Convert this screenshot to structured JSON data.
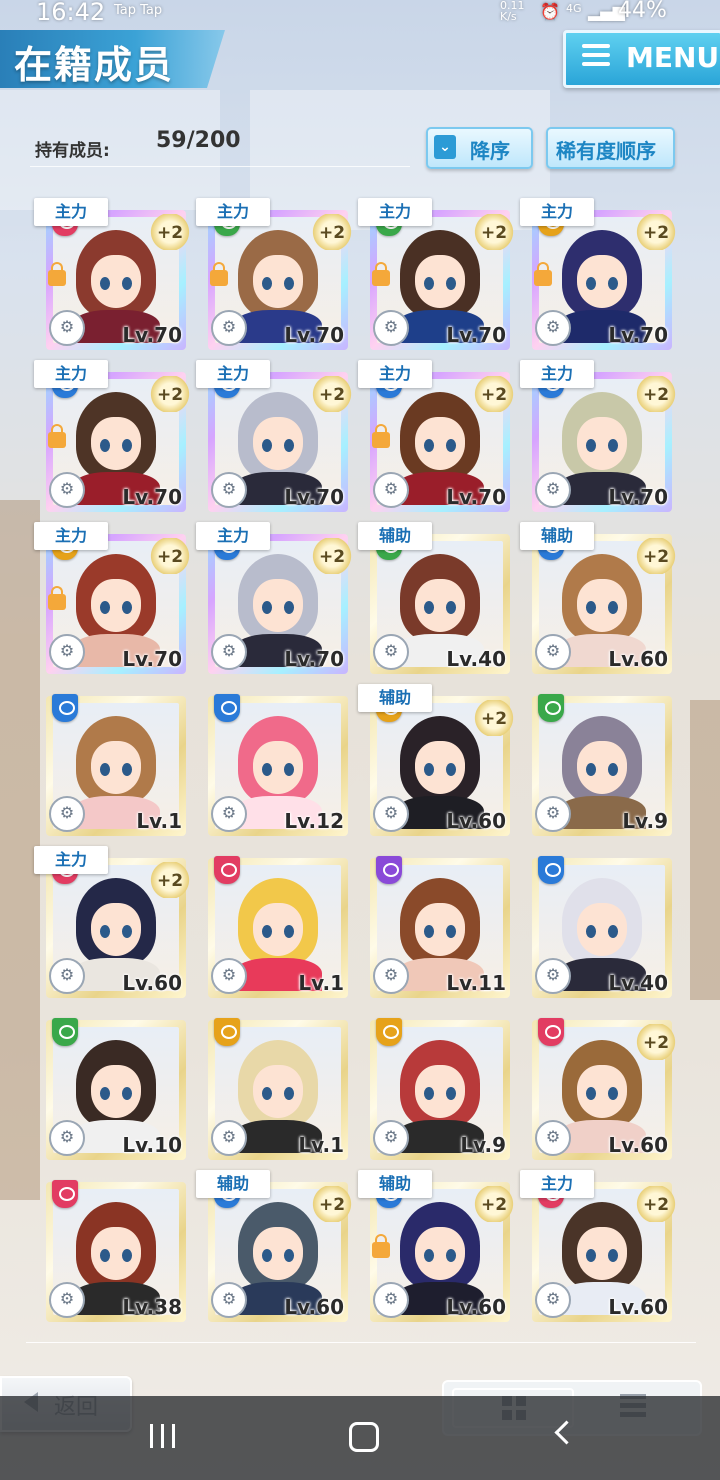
{
  "status": {
    "time": "16:42",
    "taps": "Tap  Tap",
    "speed_top": "0.11",
    "speed_bot": "K/s",
    "network": "4G",
    "battery": "44%"
  },
  "header": {
    "title": "在籍成员",
    "menu_label": "MENU"
  },
  "members": {
    "count_label": "持有成员:",
    "count_value": "59/200"
  },
  "sort": {
    "order_label": "降序",
    "order_icon": "chevron-down-icon",
    "rarity_label": "稀有度顺序"
  },
  "cards": [
    {
      "role": "主力",
      "plus": "+2",
      "level": "Lv.70",
      "attr": "red",
      "frame": "rainbow",
      "lock": true,
      "hair": "#8b3a2e",
      "skin": "#7a2030"
    },
    {
      "role": "主力",
      "plus": "+2",
      "level": "Lv.70",
      "attr": "green",
      "frame": "rainbow",
      "lock": true,
      "hair": "#9a6a46",
      "skin": "#2a3a8a"
    },
    {
      "role": "主力",
      "plus": "+2",
      "level": "Lv.70",
      "attr": "green",
      "frame": "rainbow",
      "lock": true,
      "hair": "#4a3024",
      "skin": "#1e3f8a"
    },
    {
      "role": "主力",
      "plus": "+2",
      "level": "Lv.70",
      "attr": "gold",
      "frame": "rainbow",
      "lock": true,
      "hair": "#2e2e6e",
      "skin": "#1e2a6a"
    },
    {
      "role": "主力",
      "plus": "+2",
      "level": "Lv.70",
      "attr": "blue",
      "frame": "rainbow",
      "lock": true,
      "hair": "#4e3426",
      "skin": "#9a1e2a"
    },
    {
      "role": "主力",
      "plus": "+2",
      "level": "Lv.70",
      "attr": "blue",
      "frame": "rainbow",
      "lock": false,
      "hair": "#b8bccc",
      "skin": "#2a2a3a"
    },
    {
      "role": "主力",
      "plus": "+2",
      "level": "Lv.70",
      "attr": "blue",
      "frame": "rainbow",
      "lock": true,
      "hair": "#6a3a22",
      "skin": "#9a1e2a"
    },
    {
      "role": "主力",
      "plus": "+2",
      "level": "Lv.70",
      "attr": "blue",
      "frame": "rainbow",
      "lock": false,
      "hair": "#c8c8a8",
      "skin": "#2a2a3a"
    },
    {
      "role": "主力",
      "plus": "+2",
      "level": "Lv.70",
      "attr": "gold",
      "frame": "rainbow",
      "lock": true,
      "hair": "#9a3a2a",
      "skin": "#e8b8a8"
    },
    {
      "role": "主力",
      "plus": "+2",
      "level": "Lv.70",
      "attr": "blue",
      "frame": "rainbow",
      "lock": false,
      "hair": "#b8bccc",
      "skin": "#2a2a3a"
    },
    {
      "role": "辅助",
      "plus": "",
      "level": "Lv.40",
      "attr": "green",
      "frame": "gold",
      "lock": false,
      "hair": "#7a3a2a",
      "skin": "#f0f0f0"
    },
    {
      "role": "辅助",
      "plus": "+2",
      "level": "Lv.60",
      "attr": "blue",
      "frame": "gold",
      "lock": false,
      "hair": "#b07a4a",
      "skin": "#f0d8d0"
    },
    {
      "role": "",
      "plus": "",
      "level": "Lv.1",
      "attr": "blue",
      "frame": "gold",
      "lock": false,
      "hair": "#b07a4a",
      "skin": "#f4c8c8"
    },
    {
      "role": "",
      "plus": "",
      "level": "Lv.12",
      "attr": "blue",
      "frame": "gold",
      "lock": false,
      "hair": "#f06a8a",
      "skin": "#ffe0e8"
    },
    {
      "role": "辅助",
      "plus": "+2",
      "level": "Lv.60",
      "attr": "gold",
      "frame": "gold",
      "lock": false,
      "hair": "#2a2228",
      "skin": "#1e1e24"
    },
    {
      "role": "",
      "plus": "",
      "level": "Lv.9",
      "attr": "green",
      "frame": "gold",
      "lock": false,
      "hair": "#8a8298",
      "skin": "#8a6a4a"
    },
    {
      "role": "主力",
      "plus": "+2",
      "level": "Lv.60",
      "attr": "red",
      "frame": "gold",
      "lock": false,
      "hair": "#242848",
      "skin": "#eae6e0"
    },
    {
      "role": "",
      "plus": "",
      "level": "Lv.1",
      "attr": "red",
      "frame": "gold",
      "lock": false,
      "hair": "#f2c84a",
      "skin": "#e83a5a"
    },
    {
      "role": "",
      "plus": "",
      "level": "Lv.11",
      "attr": "purple",
      "frame": "gold",
      "lock": false,
      "hair": "#8a4a2a",
      "skin": "#f0c8b8"
    },
    {
      "role": "",
      "plus": "",
      "level": "Lv.40",
      "attr": "blue",
      "frame": "gold",
      "lock": false,
      "hair": "#e0e0ea",
      "skin": "#2a2a3a"
    },
    {
      "role": "",
      "plus": "",
      "level": "Lv.10",
      "attr": "green",
      "frame": "gold",
      "lock": false,
      "hair": "#3a2a24",
      "skin": "#f0f0f0"
    },
    {
      "role": "",
      "plus": "",
      "level": "Lv.1",
      "attr": "gold",
      "frame": "gold",
      "lock": false,
      "hair": "#e8d8a8",
      "skin": "#2a2a2a"
    },
    {
      "role": "",
      "plus": "",
      "level": "Lv.9",
      "attr": "gold",
      "frame": "gold",
      "lock": false,
      "hair": "#b83a3a",
      "skin": "#2a2a2a"
    },
    {
      "role": "",
      "plus": "+2",
      "level": "Lv.60",
      "attr": "red",
      "frame": "gold",
      "lock": false,
      "hair": "#9a6a3a",
      "skin": "#f0d0c8"
    },
    {
      "role": "",
      "plus": "",
      "level": "Lv.38",
      "attr": "red",
      "frame": "gold",
      "lock": false,
      "hair": "#8a3424",
      "skin": "#2a2a2a"
    },
    {
      "role": "辅助",
      "plus": "+2",
      "level": "Lv.60",
      "attr": "blue",
      "frame": "gold",
      "lock": false,
      "hair": "#4a5a6a",
      "skin": "#2a3a5a"
    },
    {
      "role": "辅助",
      "plus": "+2",
      "level": "Lv.60",
      "attr": "blue",
      "frame": "gold",
      "lock": true,
      "hair": "#2a2a6a",
      "skin": "#1e1e2e"
    },
    {
      "role": "主力",
      "plus": "+2",
      "level": "Lv.60",
      "attr": "red",
      "frame": "gold",
      "lock": false,
      "hair": "#4a3428",
      "skin": "#e8ecf4"
    }
  ],
  "footer": {
    "back_label": "返回"
  },
  "colors": {
    "accent": "#2aa5d8",
    "role_text": "#1a6fb4"
  }
}
